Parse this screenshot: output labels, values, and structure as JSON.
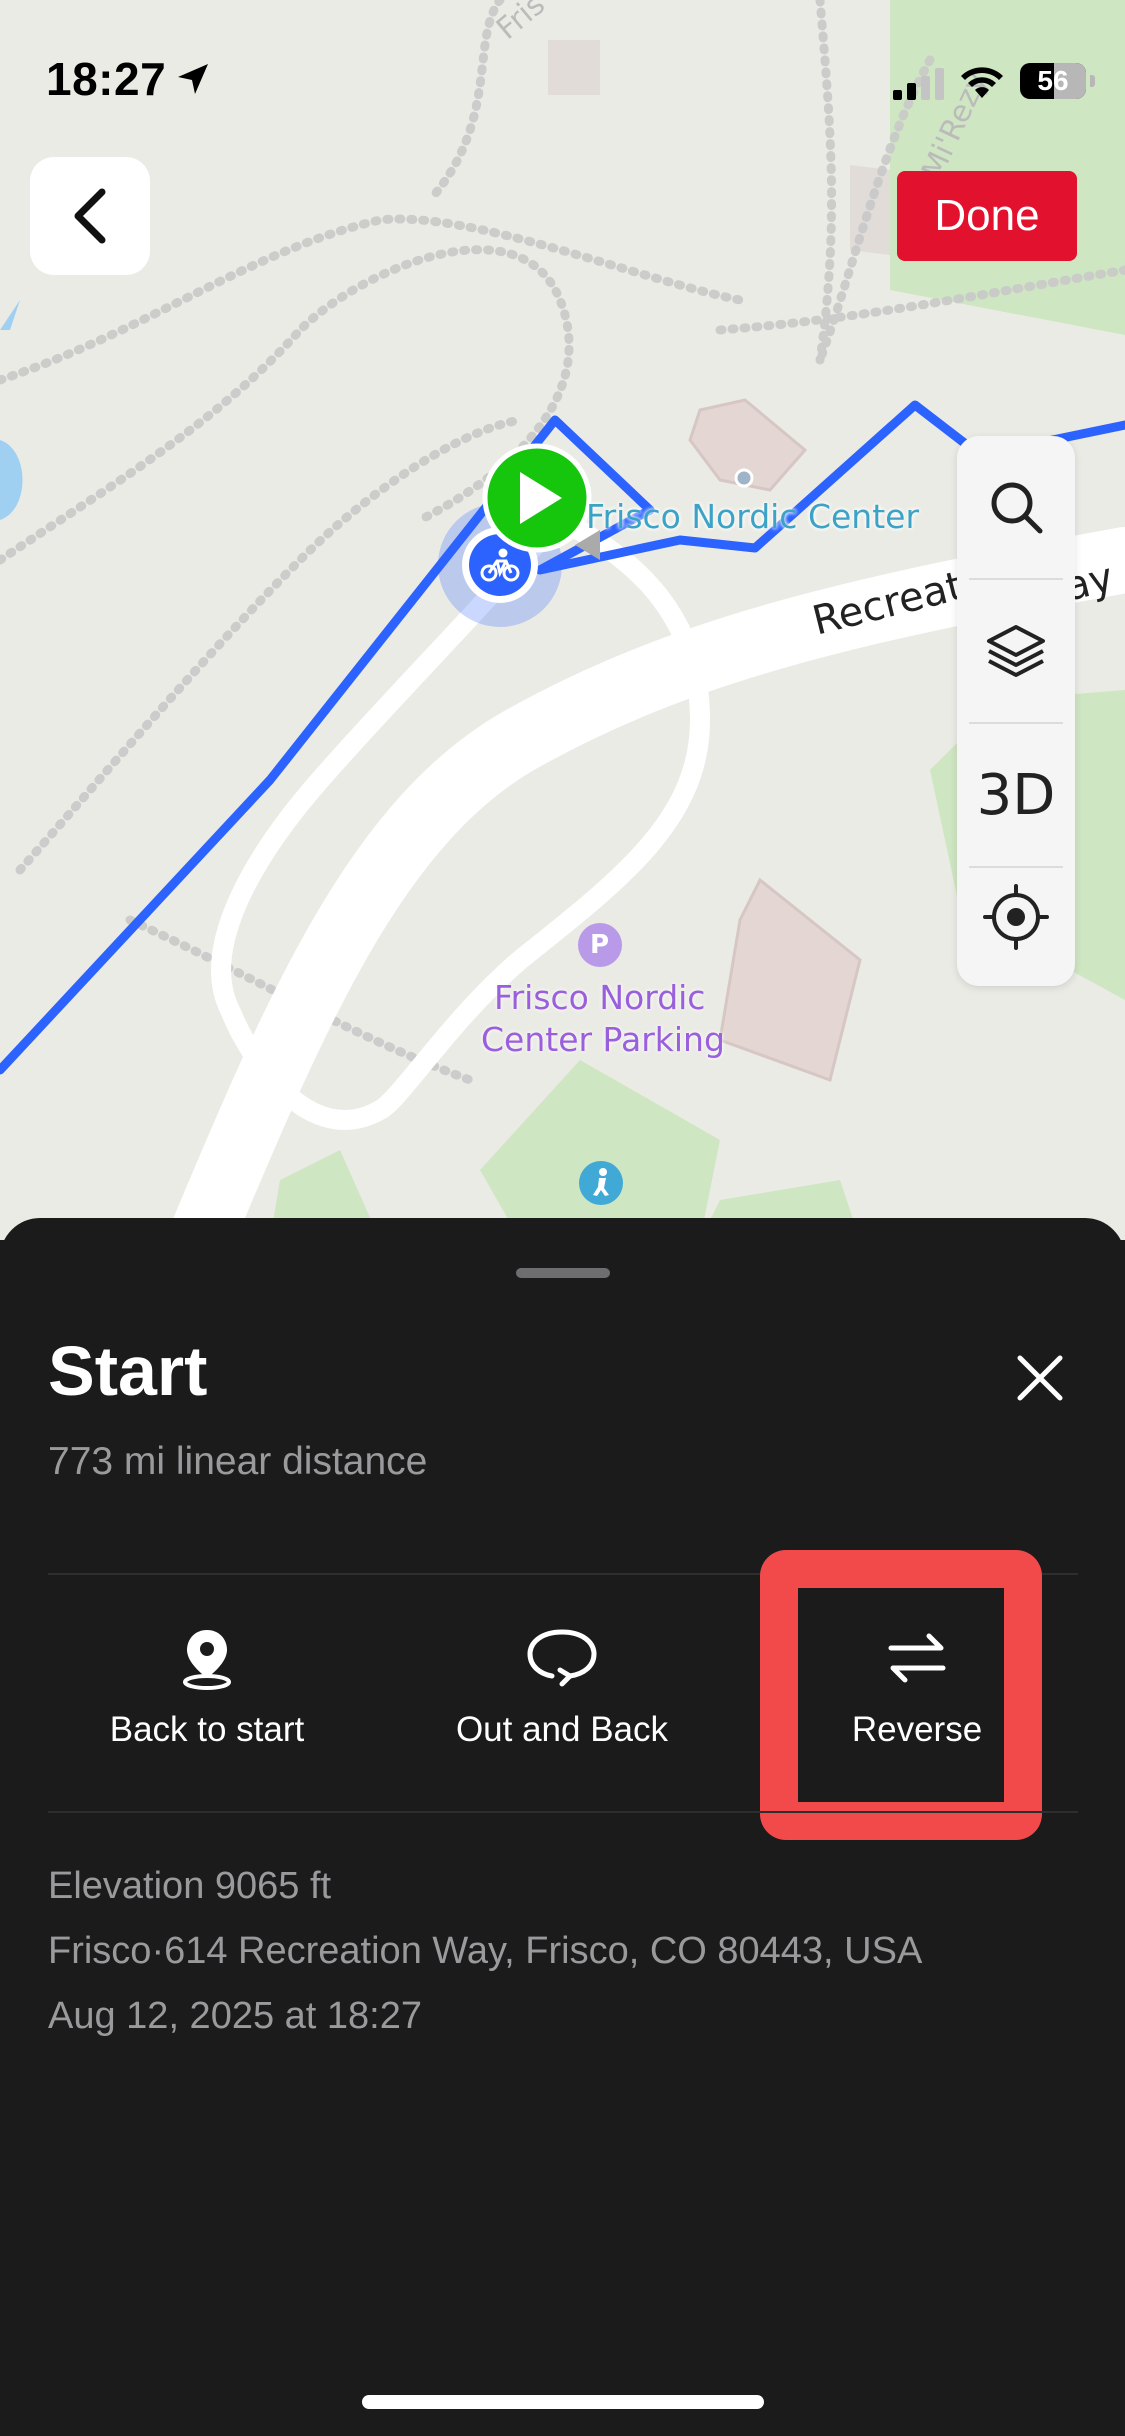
{
  "status_bar": {
    "time": "18:27",
    "battery": "56",
    "icons": [
      "location-arrow-icon",
      "cellular-signal-icon",
      "wifi-icon",
      "battery-icon"
    ]
  },
  "map": {
    "place_label": "Frisco Nordic Center",
    "parking_label_line1": "Frisco Nordic",
    "parking_label_line2": "Center Parking",
    "road_label": "Recreat",
    "road_label_tail": "ay",
    "top_road_label": "Fris",
    "top_right_road_label": "Mi'Rezy",
    "parking_glyph": "P",
    "route_color": "#2c63ff",
    "start_marker_color": "#16c60c"
  },
  "header": {
    "back_icon": "chevron-left-icon",
    "done_label": "Done"
  },
  "map_controls": {
    "items": [
      "search-icon",
      "layers-icon",
      "3D",
      "locate-icon"
    ],
    "three_d_label": "3D"
  },
  "sheet": {
    "title": "Start",
    "subtitle": "773 mi linear distance",
    "actions": [
      {
        "label": "Back to start",
        "icon": "location-pin-icon"
      },
      {
        "label": "Out and Back",
        "icon": "loop-icon"
      },
      {
        "label": "Reverse",
        "icon": "swap-arrows-icon"
      }
    ],
    "info": {
      "elevation": "Elevation 9065 ft",
      "address": "Frisco·614 Recreation Way, Frisco, CO 80443, USA",
      "datetime": "Aug 12, 2025 at 18:27"
    },
    "highlight_color": "#f24a4a"
  }
}
